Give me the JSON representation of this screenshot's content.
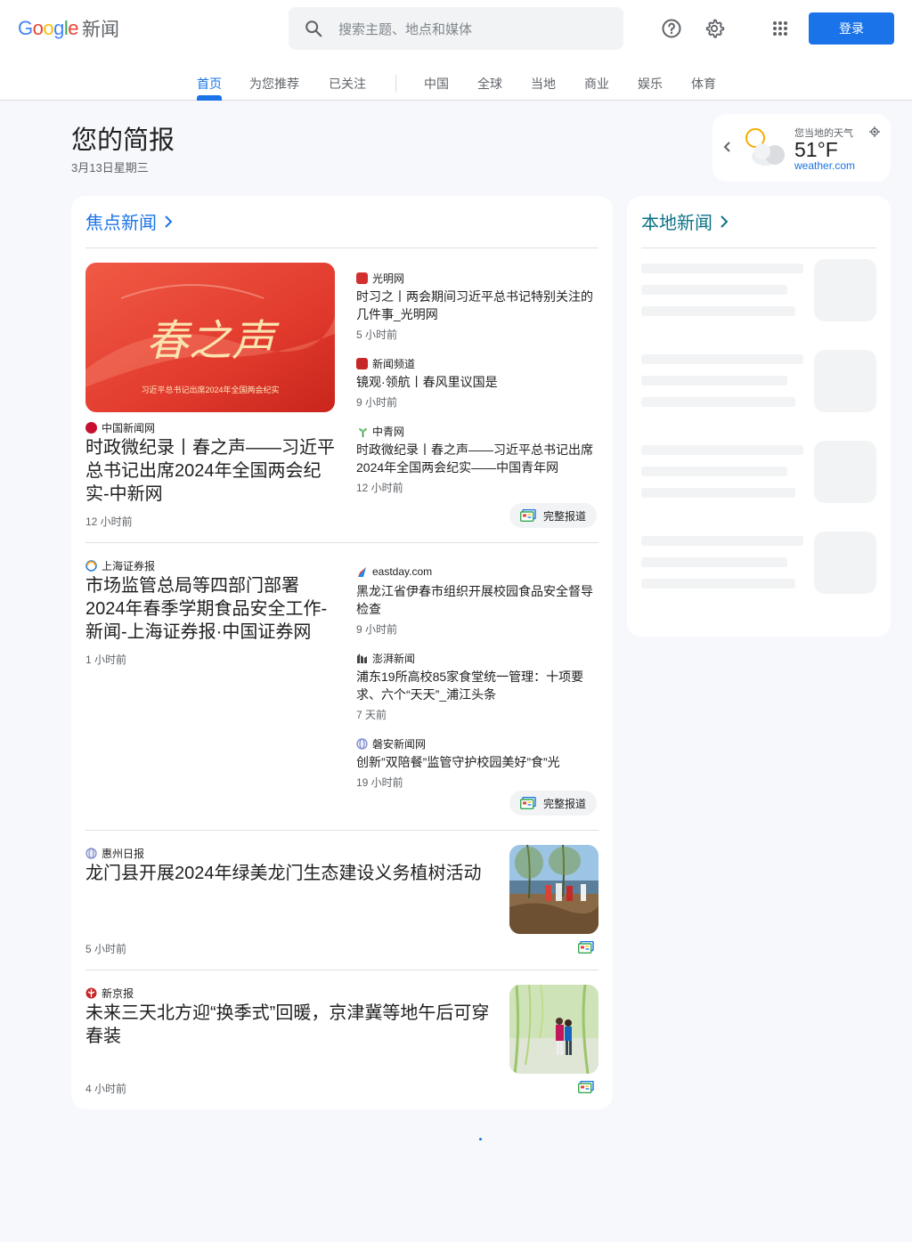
{
  "header": {
    "logo_text": "Google",
    "product_name": "新闻",
    "search_placeholder": "搜索主题、地点和媒体",
    "login_label": "登录"
  },
  "tabs": [
    {
      "label": "首页",
      "active": true
    },
    {
      "label": "为您推荐"
    },
    {
      "label": "已关注"
    },
    {
      "label": "中国"
    },
    {
      "label": "全球"
    },
    {
      "label": "当地"
    },
    {
      "label": "商业"
    },
    {
      "label": "娱乐"
    },
    {
      "label": "体育"
    }
  ],
  "briefing": {
    "title": "您的简报",
    "date": "3月13日星期三"
  },
  "weather": {
    "location_label": "您当地的天气",
    "temperature": "51°F",
    "source": "weather.com"
  },
  "top_stories": {
    "heading": "焦点新闻",
    "full_coverage_label": "完整报道",
    "cluster1": {
      "image_title": "春之声",
      "image_caption": "习近平总书记出席2024年全国两会纪实",
      "main": {
        "source": "中国新闻网",
        "title": "时政微纪录丨春之声——习近平总书记出席2024年全国两会纪实-中新网",
        "time": "12 小时前"
      },
      "related": [
        {
          "source": "光明网",
          "title": "时习之丨两会期间习近平总书记特别关注的几件事_光明网",
          "time": "5 小时前"
        },
        {
          "source": "新闻频道",
          "title": "镜观·领航丨春风里议国是",
          "time": "9 小时前"
        },
        {
          "source": "中青网",
          "title": "时政微纪录丨春之声——习近平总书记出席2024年全国两会纪实——中国青年网",
          "time": "12 小时前"
        }
      ]
    },
    "cluster2": {
      "main": {
        "source": "上海证券报",
        "title": "市场监管总局等四部门部署2024年春季学期食品安全工作-新闻-上海证券报·中国证券网",
        "time": "1 小时前"
      },
      "related": [
        {
          "source": "eastday.com",
          "title": "黑龙江省伊春市组织开展校园食品安全督导检查",
          "time": "9 小时前"
        },
        {
          "source": "澎湃新闻",
          "title": "浦东19所高校85家食堂统一管理：十项要求、六个“天天”_浦江头条",
          "time": "7 天前"
        },
        {
          "source": "磐安新闻网",
          "title": "创新”双陪餐”监管守护校园美好”食”光",
          "time": "19 小时前"
        }
      ]
    },
    "story3": {
      "source": "惠州日报",
      "title": "龙门县开展2024年绿美龙门生态建设义务植树活动",
      "time": "5 小时前"
    },
    "story4": {
      "source": "新京报",
      "title": "未来三天北方迎“换季式”回暖，京津冀等地午后可穿春装",
      "time": "4 小时前"
    }
  },
  "local_news": {
    "heading": "本地新闻"
  },
  "colors": {
    "accent": "#1a73e8",
    "local_heading": "#0b7285",
    "background": "#f6f8fc"
  }
}
